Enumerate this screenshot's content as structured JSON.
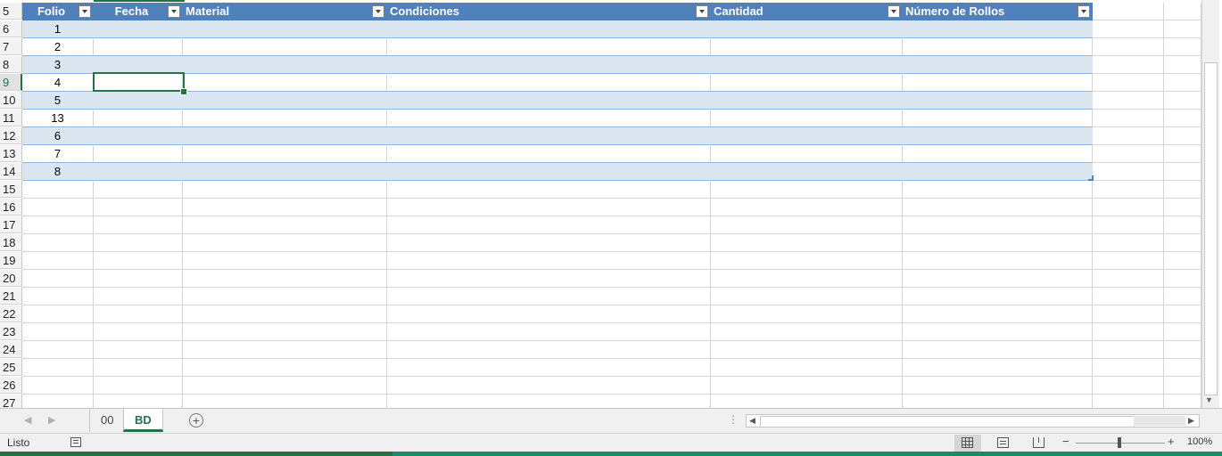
{
  "columns": {
    "folio": "Folio",
    "fecha": "Fecha",
    "material": "Material",
    "condiciones": "Condiciones",
    "cantidad": "Cantidad",
    "numero_rollos": "Número de Rollos"
  },
  "row_numbers": [
    "5",
    "6",
    "7",
    "8",
    "9",
    "10",
    "11",
    "12",
    "13",
    "14",
    "15",
    "16",
    "17",
    "18",
    "19",
    "20",
    "21",
    "22",
    "23",
    "24",
    "25",
    "26",
    "27"
  ],
  "folio_values": [
    "1",
    "2",
    "3",
    "4",
    "5",
    "13",
    "6",
    "7",
    "8"
  ],
  "active_row": "9",
  "sheets": [
    {
      "label": "00",
      "active": false
    },
    {
      "label": "BD",
      "active": true
    }
  ],
  "status": {
    "ready": "Listo",
    "zoom": "100%",
    "zoom_minus": "−",
    "zoom_plus": "+"
  },
  "colors": {
    "header": "#4f81bd",
    "band": "#dce6f1",
    "accent": "#217346"
  }
}
